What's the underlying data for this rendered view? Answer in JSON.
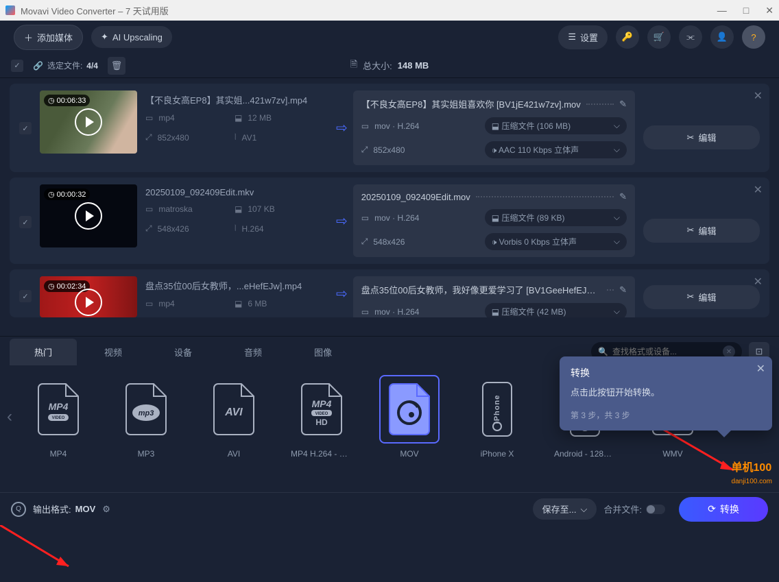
{
  "titlebar": {
    "title": "Movavi Video Converter – 7 天试用版"
  },
  "toolbar": {
    "add_media": "添加媒体",
    "ai_upscaling": "AI Upscaling",
    "settings": "设置"
  },
  "selection": {
    "label": "选定文件:",
    "count": "4/4",
    "total_size_label": "总大小:",
    "total_size": "148 MB"
  },
  "files": [
    {
      "duration": "00:06:33",
      "src_name": "【不良女高EP8】其实姐...421w7zv].mp4",
      "src_container": "mp4",
      "src_size": "12 MB",
      "src_res": "852x480",
      "src_vcodec": "AV1",
      "out_name": "【不良女高EP8】其实姐姐喜欢你 [BV1jE421w7zv].mov",
      "out_format": "mov · H.264",
      "out_compress": "压缩文件 (106 MB)",
      "out_res": "852x480",
      "out_audio": "AAC 110 Kbps 立体声",
      "edit": "编辑"
    },
    {
      "duration": "00:00:32",
      "src_name": "20250109_092409Edit.mkv",
      "src_container": "matroska",
      "src_size": "107 KB",
      "src_res": "548x426",
      "src_vcodec": "H.264",
      "out_name": "20250109_092409Edit.mov",
      "out_format": "mov · H.264",
      "out_compress": "压缩文件 (89 KB)",
      "out_res": "548x426",
      "out_audio": "Vorbis 0 Kbps 立体声",
      "edit": "编辑"
    },
    {
      "duration": "00:02:34",
      "src_name": "盘点35位00后女教师，...eHefEJw].mp4",
      "src_container": "mp4",
      "src_size": "6 MB",
      "src_res": "",
      "src_vcodec": "",
      "out_name": "盘点35位00后女教师，我好像更爱学习了 [BV1GeeHefEJw].mov",
      "out_format": "mov · H.264",
      "out_compress": "压缩文件 (42 MB)",
      "out_res": "",
      "out_audio": "",
      "edit": "编辑"
    }
  ],
  "format_tabs": [
    "热门",
    "视频",
    "设备",
    "音频",
    "图像"
  ],
  "search_placeholder": "查找格式或设备...",
  "formats": [
    {
      "label": "MP4",
      "badge": "MP4",
      "sub": "VIDEO"
    },
    {
      "label": "MP3",
      "badge": "mp3",
      "sub": ""
    },
    {
      "label": "AVI",
      "badge": "AVI",
      "sub": ""
    },
    {
      "label": "MP4 H.264 - HD 7...",
      "badge": "MP4",
      "sub": "HD"
    },
    {
      "label": "MOV",
      "badge": "MOV",
      "sub": "",
      "selected": true
    },
    {
      "label": "iPhone X",
      "badge": "iPhone",
      "sub": ""
    },
    {
      "label": "Android - 1280x7...",
      "badge": "AND",
      "sub": ""
    },
    {
      "label": "WMV",
      "badge": "WMV",
      "sub": ""
    }
  ],
  "tooltip": {
    "title": "转换",
    "text": "点击此按钮开始转换。",
    "step": "第 3 步，共 3 步"
  },
  "bottom": {
    "out_label": "输出格式:",
    "out_value": "MOV",
    "save_to": "保存至...",
    "merge": "合并文件:",
    "convert": "转换"
  },
  "watermark": {
    "line1": "单机100",
    "line2": "danji100.com"
  }
}
